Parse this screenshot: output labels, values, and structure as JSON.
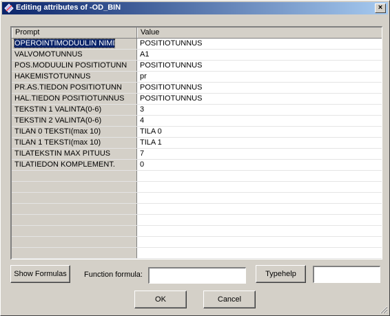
{
  "window": {
    "title": "Editing attributes of -OD_BIN",
    "close_label": "×"
  },
  "grid": {
    "columns": [
      "Prompt",
      "Value"
    ],
    "rows": [
      {
        "prompt": "OPEROINTIMODUULIN NIMI",
        "value": "POSITIOTUNNUS",
        "selected": true
      },
      {
        "prompt": "VALVOMOTUNNUS",
        "value": "A1"
      },
      {
        "prompt": "POS.MODUULIN POSITIOTUNN",
        "value": "POSITIOTUNNUS"
      },
      {
        "prompt": "HAKEMISTOTUNNUS",
        "value": "pr"
      },
      {
        "prompt": "PR.AS.TIEDON POSITIOTUNN",
        "value": "POSITIOTUNNUS"
      },
      {
        "prompt": "HAL.TIEDON POSITIOTUNNUS",
        "value": "POSITIOTUNNUS"
      },
      {
        "prompt": "TEKSTIN 1 VALINTA(0-6)",
        "value": "3"
      },
      {
        "prompt": "TEKSTIN 2 VALINTA(0-6)",
        "value": "4"
      },
      {
        "prompt": "TILAN 0 TEKSTI(max 10)",
        "value": "TILA  0"
      },
      {
        "prompt": "TILAN 1 TEKSTI(max 10)",
        "value": "TILA  1"
      },
      {
        "prompt": "TILATEKSTIN MAX PITUUS",
        "value": "7"
      },
      {
        "prompt": "TILATIEDON KOMPLEMENT.",
        "value": "0"
      }
    ],
    "empty_rows": 9
  },
  "footer": {
    "show_formulas_label": "Show Formulas",
    "function_formula_label": "Function formula:",
    "function_formula_value": "",
    "typehelp_label": "Typehelp",
    "typehelp_value": "",
    "ok_label": "OK",
    "cancel_label": "Cancel"
  },
  "colors": {
    "title_active": "#0a246a",
    "face": "#d4d0c8",
    "selection": "#0a246a"
  }
}
